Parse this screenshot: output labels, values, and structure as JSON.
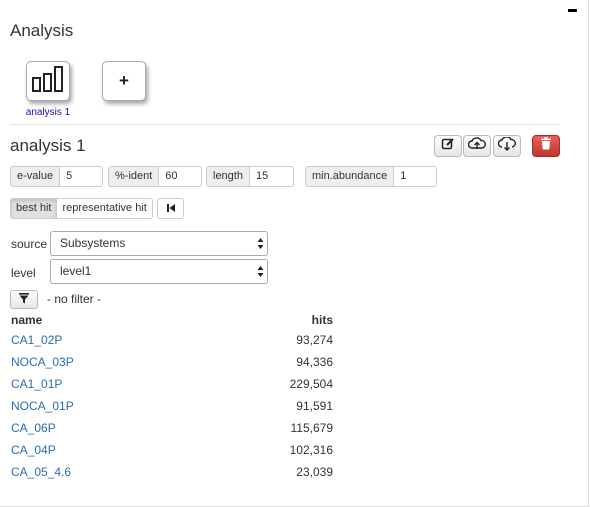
{
  "panel": {
    "title": "Analysis"
  },
  "tiles": [
    {
      "label": "analysis 1",
      "icon": "bar-chart-icon"
    },
    {
      "label": "+",
      "icon": "add-icon"
    }
  ],
  "analysis": {
    "name": "analysis 1",
    "tools": [
      "edit-icon",
      "upload-icon",
      "download-icon",
      "trash-icon"
    ]
  },
  "params": [
    {
      "label": "e-value",
      "value": "5"
    },
    {
      "label": "%-ident",
      "value": "60"
    },
    {
      "label": "length",
      "value": "15"
    },
    {
      "label": "min.abundance",
      "value": "1"
    }
  ],
  "hit_mode": {
    "options": [
      "best hit",
      "representative hit"
    ],
    "active": "best hit"
  },
  "source": {
    "label": "source",
    "value": "Subsystems"
  },
  "level": {
    "label": "level",
    "value": "level1"
  },
  "filter": {
    "text": "- no filter -"
  },
  "table": {
    "columns": [
      "name",
      "hits"
    ],
    "rows": [
      {
        "name": "CA1_02P",
        "hits": "93,274"
      },
      {
        "name": "NOCA_03P",
        "hits": "94,336"
      },
      {
        "name": "CA1_01P",
        "hits": "229,504"
      },
      {
        "name": "NOCA_01P",
        "hits": "91,591"
      },
      {
        "name": "CA_06P",
        "hits": "115,679"
      },
      {
        "name": "CA_04P",
        "hits": "102,316"
      },
      {
        "name": "CA_05_4.6",
        "hits": "23,039"
      }
    ]
  },
  "colors": {
    "link": "#2a6db0",
    "danger": "#d9534f",
    "tile_label": "#1a0dab"
  }
}
